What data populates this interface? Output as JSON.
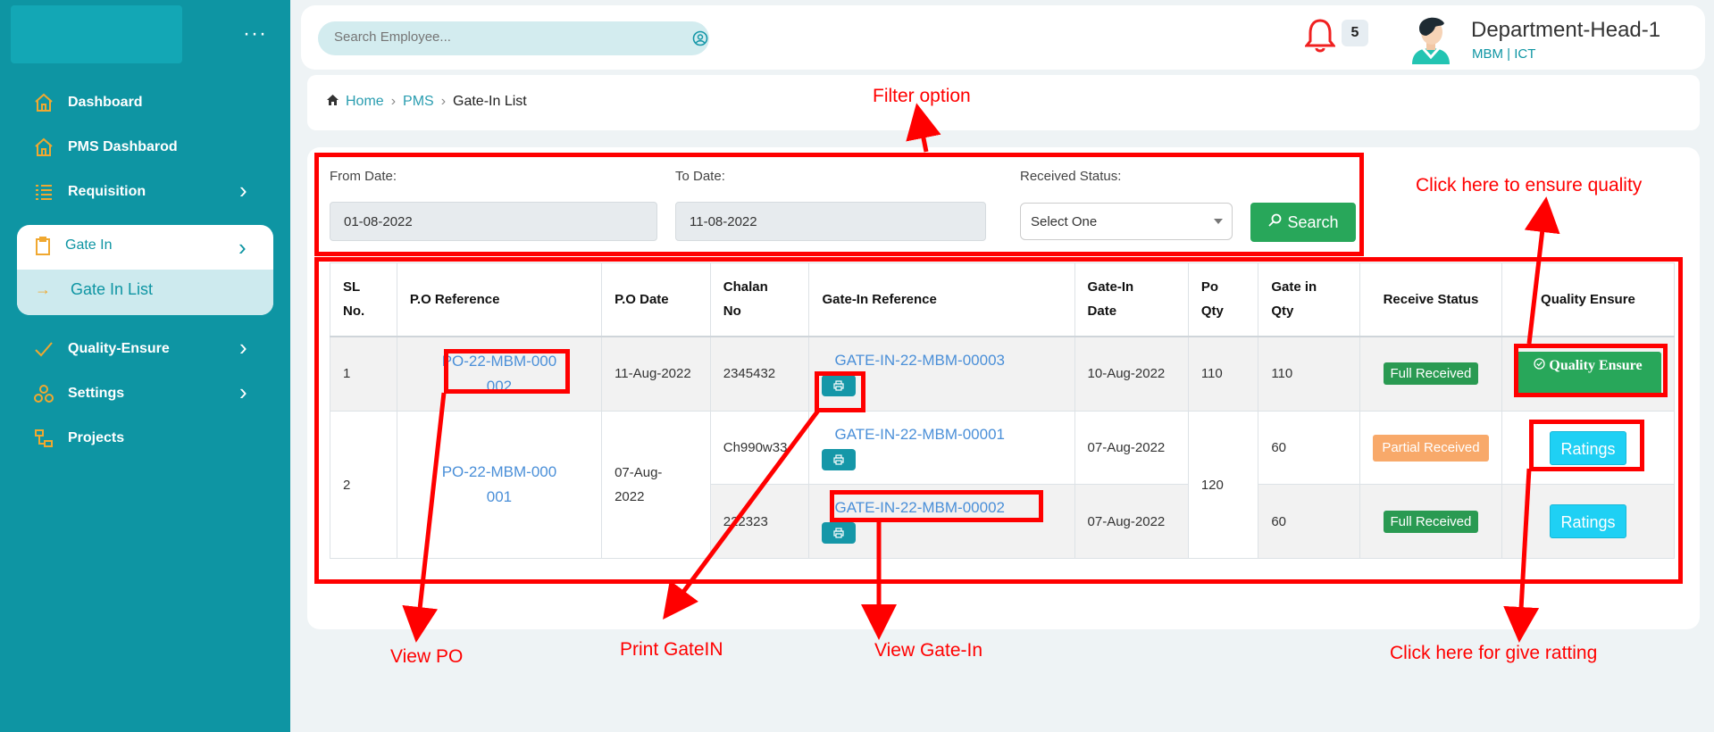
{
  "sidebar": {
    "items": [
      {
        "label": "Dashboard"
      },
      {
        "label": "PMS Dashbarod"
      },
      {
        "label": "Requisition"
      },
      {
        "label": "Gate In"
      },
      {
        "label": "Gate In List"
      },
      {
        "label": "Quality-Ensure"
      },
      {
        "label": "Settings"
      },
      {
        "label": "Projects"
      }
    ],
    "icon_color": "#f0a830"
  },
  "header": {
    "search_placeholder": "Search Employee...",
    "notification_count": "5",
    "user_name": "Department-Head-1",
    "user_org": "MBM  | ICT"
  },
  "breadcrumb": {
    "home": "Home",
    "pms": "PMS",
    "current": "Gate-In List"
  },
  "filters": {
    "from_label": "From Date:",
    "from_value": "01-08-2022",
    "to_label": "To Date:",
    "to_value": "11-08-2022",
    "status_label": "Received Status:",
    "status_value": "Select One",
    "search_label": "Search"
  },
  "table": {
    "headers": {
      "sl": "SL No.",
      "po_ref": "P.O Reference",
      "po_date": "P.O Date",
      "chalan": "Chalan No",
      "gate_ref": "Gate-In Reference",
      "gate_date": "Gate-In Date",
      "po_qty": "Po Qty",
      "gate_qty": "Gate in Qty",
      "receive_status": "Receive Status",
      "quality": "Quality Ensure"
    },
    "rows": [
      {
        "sl": "1",
        "po_ref": "PO-22-MBM-000002",
        "po_date": "11-Aug-2022",
        "chalan": "2345432",
        "gate_ref": "GATE-IN-22-MBM-00003",
        "gate_date": "10-Aug-2022",
        "po_qty": "110",
        "gate_qty": "110",
        "status": "Full Received",
        "action": "Quality Ensure"
      },
      {
        "sl": "2",
        "po_ref": "PO-22-MBM-000001",
        "po_date": "07-Aug-2022",
        "chalan": "Ch990w33",
        "gate_ref": "GATE-IN-22-MBM-00001",
        "gate_date": "07-Aug-2022",
        "po_qty": "120",
        "gate_qty": "60",
        "status": "Partial Received",
        "action": "Ratings"
      },
      {
        "chalan": "222323",
        "gate_ref": "GATE-IN-22-MBM-00002",
        "gate_date": "07-Aug-2022",
        "gate_qty": "60",
        "status": "Full Received",
        "action": "Ratings"
      }
    ]
  },
  "annotations": {
    "filter": "Filter option",
    "quality": "Click here to ensure quality",
    "view_po": "View PO",
    "print": "Print GateIN",
    "view_gate": "View Gate-In",
    "rating": "Click here for give ratting"
  },
  "colors": {
    "sidebar": "#0e95a3",
    "accent": "#28a75a",
    "annotation": "#ff0000",
    "link": "#4a8fd8"
  }
}
